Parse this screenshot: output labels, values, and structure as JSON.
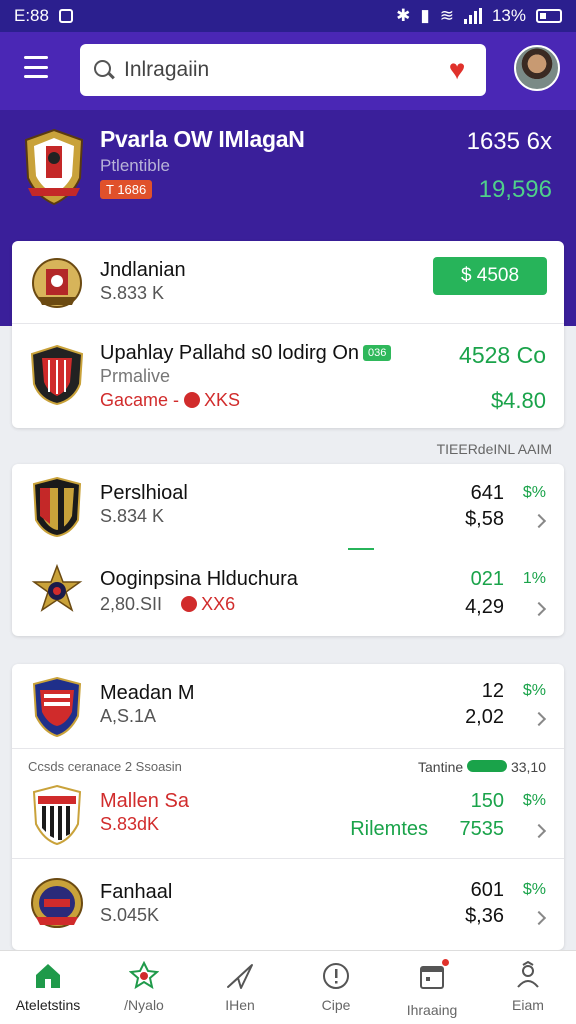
{
  "status_bar": {
    "time": "E:88",
    "battery": "13%"
  },
  "header": {
    "search_value": "Inlragaiin",
    "search_placeholder": "Inlragaiin"
  },
  "hero": {
    "title": "Pvarla OW IMlagaN",
    "subtitle": "Ptlentible",
    "badge": "T 1686",
    "value_primary": "1635 6x",
    "value_secondary": "19,596"
  },
  "card1": {
    "row1": {
      "name": "Jndlanian",
      "sub": "S.833 K",
      "price_button": "$ 4508"
    },
    "row2": {
      "name": "Upahlay Pallahd s0 lodirg On",
      "badge": "036",
      "sub": "Prmalive",
      "sub2": "Gacame -",
      "sub2b": "XKS",
      "value1": "4528 Co",
      "value2": "$4.80"
    }
  },
  "section1_label": "TIEERdeINL AAIM",
  "card2": {
    "row1": {
      "name": "Perslhioal",
      "sub": "S.834 K",
      "num": "641",
      "pct": "$%",
      "value": "$,58"
    },
    "row2": {
      "name": "Ooginpsina Hlduchura",
      "sub": "2,80.SII",
      "mark": "XX6",
      "num": "021",
      "pct": "1%",
      "value": "4,29"
    }
  },
  "card3": {
    "row1": {
      "name": "Meadan M",
      "sub": "A,S.1A",
      "num": "12",
      "pct": "$%",
      "value": "2,02"
    },
    "section_left": "Ccsds ceranace 2 Ssoasin",
    "section_right_label": "Tantine",
    "section_right_value": "33,10",
    "row2": {
      "name": "Mallen Sa",
      "sub": "S.83dK",
      "num": "150",
      "pct": "$%",
      "extra_label": "Rilemtes",
      "value": "7535"
    },
    "row3": {
      "name": "Fanhaal",
      "sub": "S.045K",
      "num": "601",
      "pct": "$%",
      "value": "$,36"
    }
  },
  "bottom_nav": [
    {
      "label": "Ateletstins",
      "icon": "home-icon"
    },
    {
      "label": "/Nyalo",
      "icon": "star-badge-icon"
    },
    {
      "label": "IHen",
      "icon": "send-icon"
    },
    {
      "label": "Cipe",
      "icon": "alert-circle-icon"
    },
    {
      "label": "Ihraaing",
      "icon": "calendar-icon"
    },
    {
      "label": "Eiam",
      "icon": "user-icon"
    }
  ],
  "colors": {
    "header": "#4a27b5",
    "hero": "#3a1f9a",
    "accent_green": "#27b45a",
    "accent_red": "#d12c2c"
  }
}
